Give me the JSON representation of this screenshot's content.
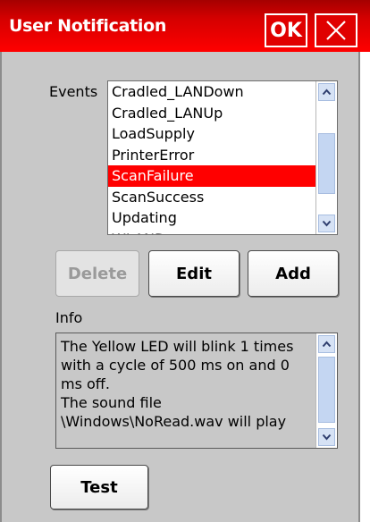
{
  "window": {
    "title": "User Notification",
    "ok_label": "OK"
  },
  "events": {
    "label": "Events",
    "items": [
      "Cradled_LANDown",
      "Cradled_LANUp",
      "LoadSupply",
      "PrinterError",
      "ScanFailure",
      "ScanSuccess",
      "Updating",
      "WLANDown"
    ],
    "selected": "ScanFailure",
    "scroll_fraction": 0.6
  },
  "buttons": {
    "delete": "Delete",
    "edit": "Edit",
    "add": "Add",
    "test": "Test"
  },
  "info": {
    "label": "Info",
    "lines": [
      "The Yellow LED will blink 1 times",
      "with a cycle of 500 ms on and 0",
      "ms off.",
      "The sound file",
      "\\Windows\\NoRead.wav will play"
    ]
  },
  "colors": {
    "title_bar": "#ff0000",
    "selection": "#ff0000",
    "background": "#c8c8c8"
  },
  "icons": {
    "close": "close-icon",
    "scroll_up": "chevron-up-icon",
    "scroll_down": "chevron-down-icon"
  }
}
